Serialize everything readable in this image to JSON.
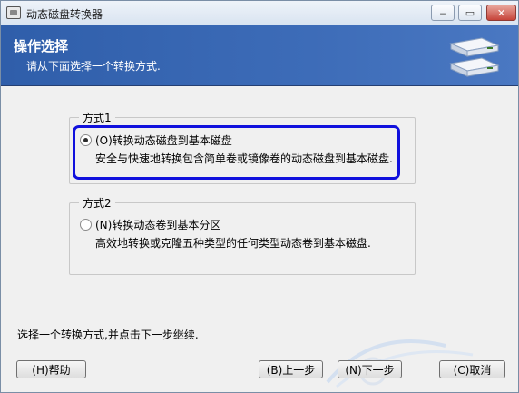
{
  "window": {
    "title": "动态磁盘转换器",
    "controls": {
      "minimize": "‒",
      "maximize": "▭",
      "close": "✕"
    }
  },
  "banner": {
    "title": "操作选择",
    "subtitle": "请从下面选择一个转换方式.",
    "icon": "disk-convert-icon"
  },
  "options": [
    {
      "legend": "方式1",
      "label": "(O)转换动态磁盘到基本磁盘",
      "description": "安全与快速地转换包含简单卷或镜像卷的动态磁盘到基本磁盘.",
      "checked": true
    },
    {
      "legend": "方式2",
      "label": "(N)转换动态卷到基本分区",
      "description": "高效地转换或克隆五种类型的任何类型动态卷到基本磁盘.",
      "checked": false
    }
  ],
  "footer": {
    "instruction": "选择一个转换方式,并点击下一步继续.",
    "help": "(H)帮助",
    "back": "(B)上一步",
    "next": "(N)下一步",
    "cancel": "(C)取消"
  },
  "colors": {
    "banner": "#3d6cb8",
    "highlight_border": "#1010dd",
    "close_button": "#c7443a"
  }
}
